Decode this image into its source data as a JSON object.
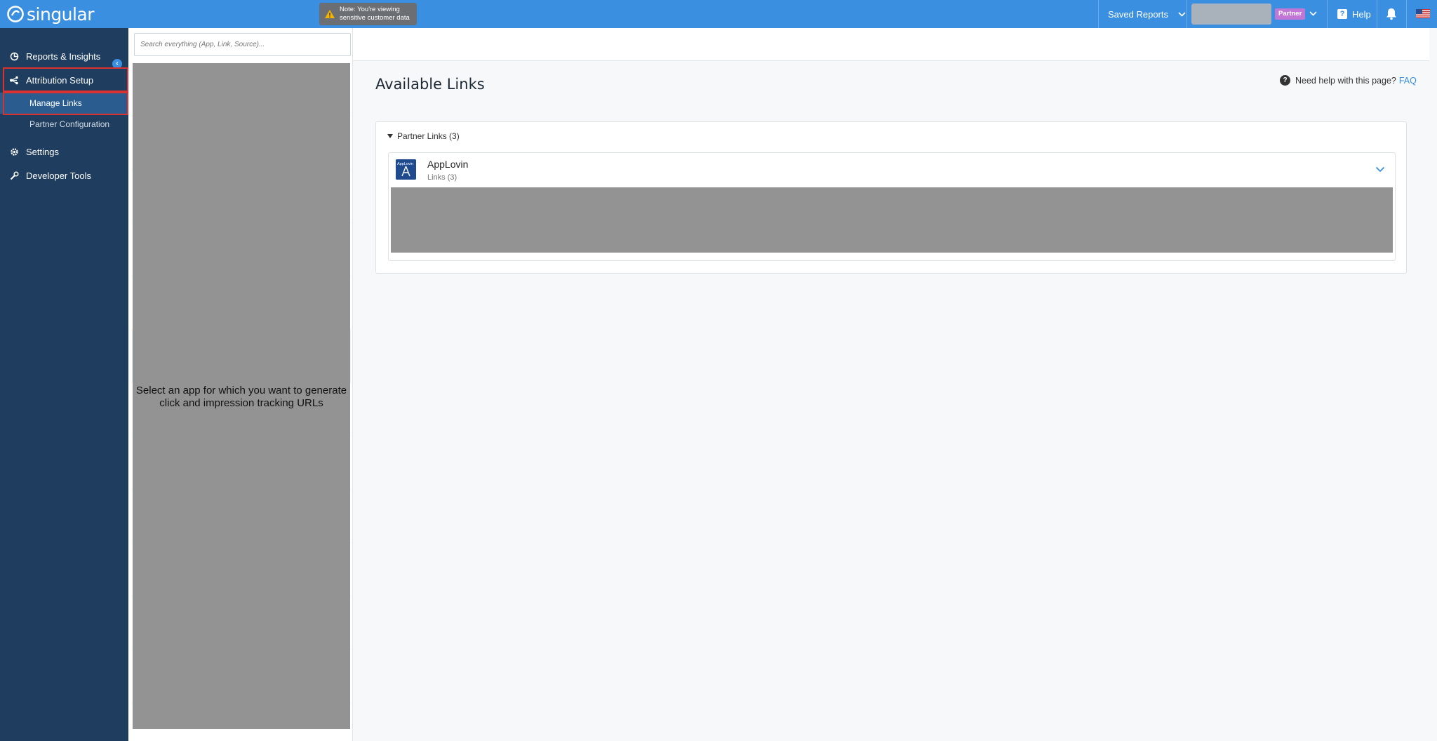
{
  "topbar": {
    "brand": "singular",
    "note_line1": "Note: You're viewing",
    "note_line2": "sensitive customer data",
    "saved_reports": "Saved Reports",
    "partner_badge": "Partner",
    "help": "Help"
  },
  "sidebar": {
    "items": [
      {
        "label": "Reports & Insights",
        "icon": "reports-icon"
      },
      {
        "label": "Attribution Setup",
        "icon": "attribution-icon"
      },
      {
        "label": "Settings",
        "icon": "gear-icon"
      },
      {
        "label": "Developer Tools",
        "icon": "wrench-icon"
      }
    ],
    "sub_items": [
      "Manage Links",
      "Partner Configuration"
    ]
  },
  "search": {
    "placeholder": "Search everything (App, Link, Source)..."
  },
  "hint": {
    "line1": "Select an app for which you want to generate",
    "line2": "click and impression tracking URLs"
  },
  "main": {
    "title": "Available Links",
    "need_help": "Need help with this page?",
    "faq": "FAQ",
    "group": "Partner Links (3)",
    "partner_name": "AppLovin",
    "partner_links": "Links (3)"
  },
  "colors": {
    "topbar": "#3a8fe0",
    "sidebar": "#1f3d5f",
    "highlight": "#d9322f",
    "partner_badge": "#c277d6"
  }
}
